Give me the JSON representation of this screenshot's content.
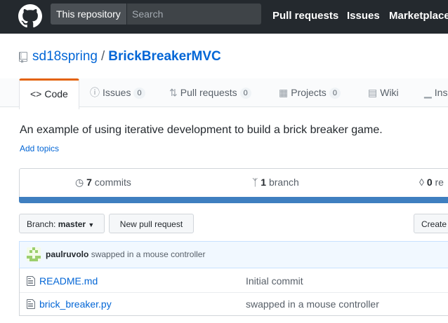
{
  "header": {
    "scope_label": "This repository",
    "search_placeholder": "Search",
    "nav": [
      "Pull requests",
      "Issues",
      "Marketplace"
    ]
  },
  "repo": {
    "owner": "sd18spring",
    "separator": "/",
    "name": "BrickBreakerMVC"
  },
  "tabs": [
    {
      "label": "Code",
      "icon": "code-icon"
    },
    {
      "label": "Issues",
      "count": "0",
      "icon": "issue-icon"
    },
    {
      "label": "Pull requests",
      "count": "0",
      "icon": "pull-request-icon"
    },
    {
      "label": "Projects",
      "count": "0",
      "icon": "project-icon"
    },
    {
      "label": "Wiki",
      "icon": "book-icon"
    },
    {
      "label": "Ins",
      "icon": "graph-icon"
    }
  ],
  "description": "An example of using iterative development to build a brick breaker game.",
  "add_topics": "Add topics",
  "summary": {
    "commits_count": "7",
    "commits_label": "commits",
    "branches_count": "1",
    "branches_label": "branch",
    "releases_count": "0",
    "releases_label": "re"
  },
  "toolbar": {
    "branch_prefix": "Branch:",
    "branch_name": "master",
    "new_pr": "New pull request",
    "create": "Create"
  },
  "latest_commit": {
    "author": "paulruvolo",
    "message": "swapped in a mouse controller"
  },
  "files": [
    {
      "name": "README.md",
      "message": "Initial commit"
    },
    {
      "name": "brick_breaker.py",
      "message": "swapped in a mouse controller"
    }
  ],
  "colors": {
    "header_bg": "#24292e",
    "link": "#0366d6",
    "tab_accent": "#e36209",
    "language_bar": "#3f7fc0"
  }
}
